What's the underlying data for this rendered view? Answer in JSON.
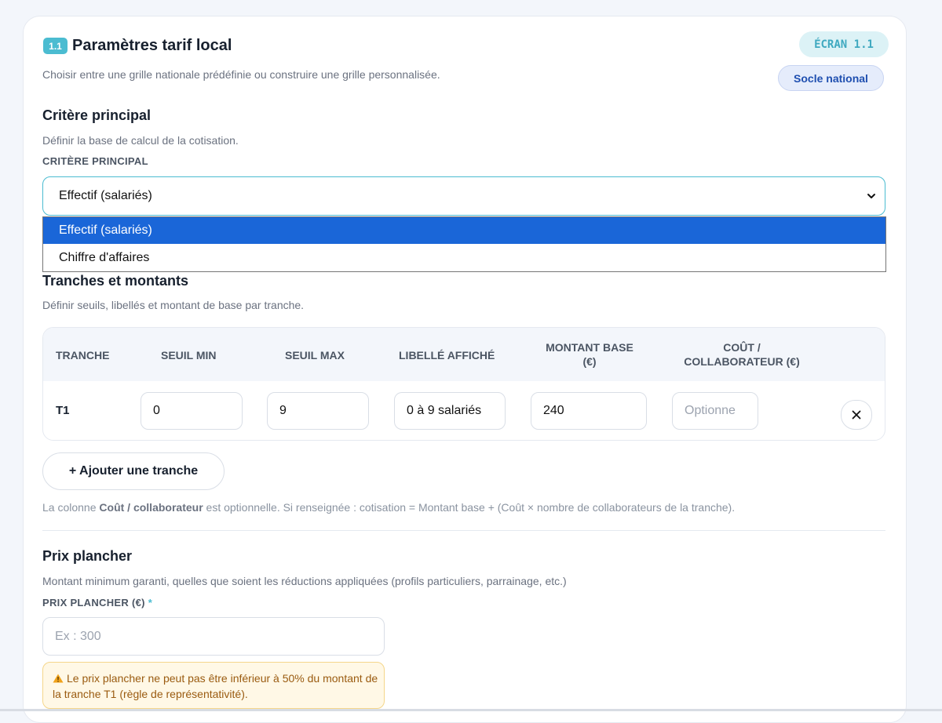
{
  "header": {
    "number_badge": "1.1",
    "title": "Paramètres tarif local",
    "subtitle": "Choisir entre une grille nationale prédéfinie ou construire une grille personnalisée.",
    "screen_badge": "ÉCRAN 1.1",
    "mode_badge": "Socle national"
  },
  "criteria": {
    "title": "Critère principal",
    "description": "Définir la base de calcul de la cotisation.",
    "field_label": "CRITÈRE PRINCIPAL",
    "selected": "Effectif (salariés)",
    "options": [
      "Effectif (salariés)",
      "Chiffre d'affaires"
    ]
  },
  "tranches": {
    "title": "Tranches et montants",
    "description": "Définir seuils, libellés et montant de base par tranche.",
    "columns": [
      "TRANCHE",
      "SEUIL MIN",
      "SEUIL MAX",
      "LIBELLÉ AFFICHÉ",
      "MONTANT BASE (€)",
      "COÛT / COLLABORATEUR (€)"
    ],
    "column_lines": {
      "montant": [
        "MONTANT BASE",
        "(€)"
      ],
      "cout": [
        "COÛT /",
        "COLLABORATEUR (€)"
      ]
    },
    "rows": [
      {
        "tranche": "T1",
        "seuil_min": "0",
        "seuil_max": "9",
        "libelle": "0 à 9 salariés",
        "montant": "240",
        "cout_placeholder": "Optionne"
      }
    ],
    "add_label": "+ Ajouter une tranche",
    "note_prefix": "La colonne ",
    "note_bold": "Coût / collaborateur",
    "note_suffix": " est optionnelle. Si renseignée : cotisation = Montant base + (Coût × nombre de collaborateurs de la tranche)."
  },
  "floor_price": {
    "title": "Prix plancher",
    "description": "Montant minimum garanti, quelles que soient les réductions appliquées (profils particuliers, parrainage, etc.)",
    "field_label": "PRIX PLANCHER (€)",
    "required_mark": "*",
    "placeholder": "Ex : 300",
    "warning_icon": "warning-icon",
    "warning": "Le prix plancher ne peut pas être inférieur à 50% du montant de la tranche T1 (règle de représentativité)."
  },
  "colors": {
    "accent": "#4bbcd1",
    "selected_option": "#1a66d8",
    "badge_blue": "#1f4fb0",
    "warning_bg": "#fff8e6"
  }
}
